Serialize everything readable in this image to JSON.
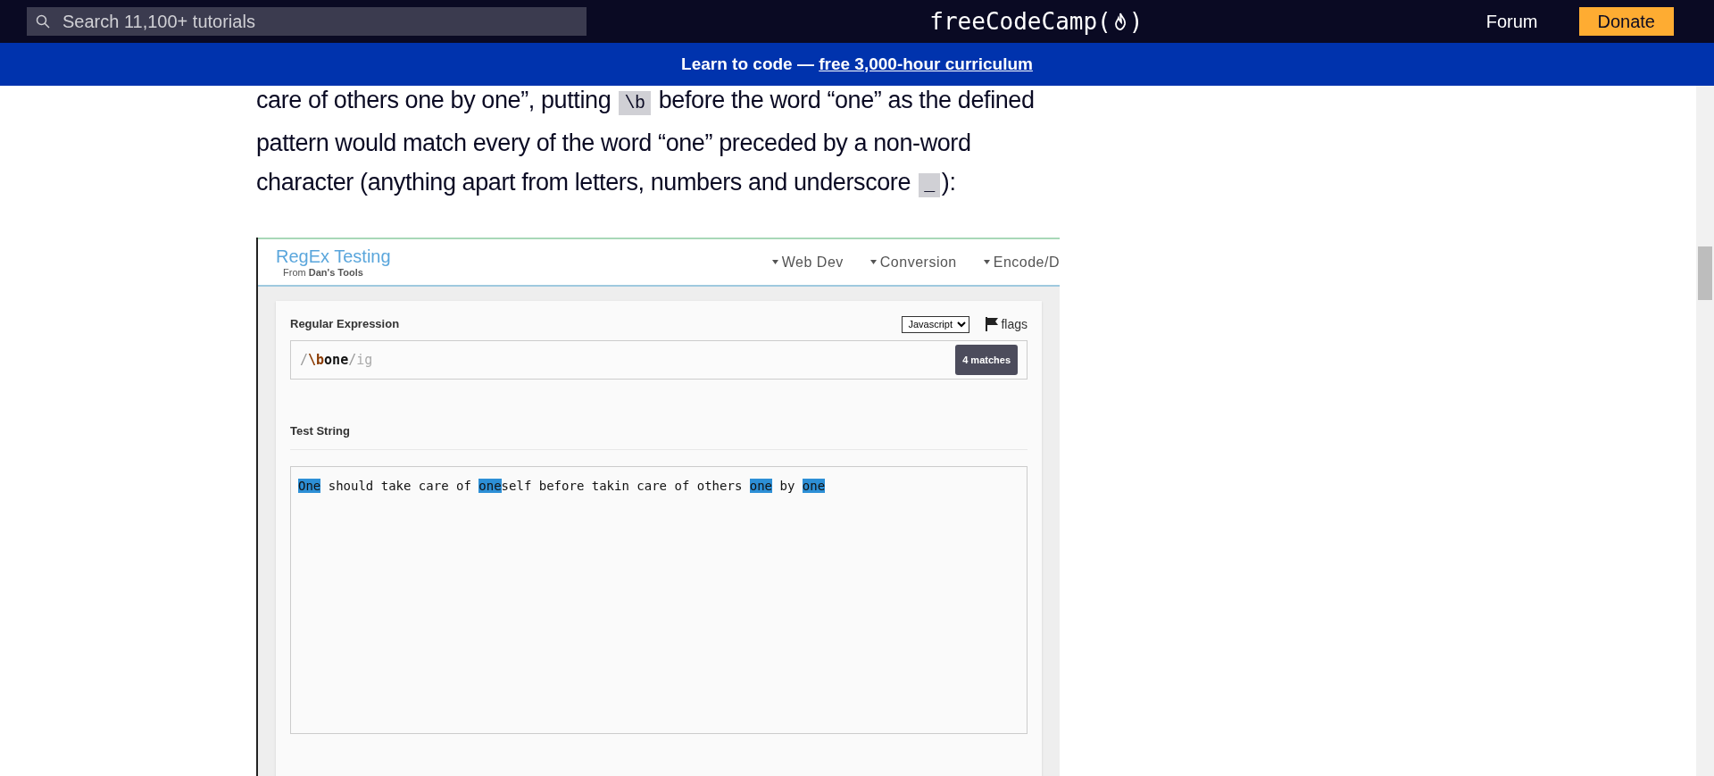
{
  "nav": {
    "search_placeholder": "Search 11,100+ tutorials",
    "logo_before": "freeCodeCamp(",
    "logo_after": ")",
    "forum": "Forum",
    "donate": "Donate"
  },
  "banner": {
    "text": "Learn to code — ",
    "link": "free 3,000-hour curriculum"
  },
  "article": {
    "paragraph": [
      {
        "kind": "text",
        "text": "care of others one by one”, putting "
      },
      {
        "kind": "code",
        "text": "\\b"
      },
      {
        "kind": "text",
        "text": " before the word “one” as the defined pattern would match every of the word “one” preceded by a non-word character (anything apart from letters, numbers and underscore "
      },
      {
        "kind": "code",
        "text": "_"
      },
      {
        "kind": "text",
        "text": "):"
      }
    ]
  },
  "screenshot": {
    "title": "RegEx Testing",
    "subtitle_prefix": "From ",
    "subtitle_bold": "Dan's Tools",
    "menu": [
      "Web Dev",
      "Conversion",
      "Encode/D"
    ],
    "regex_label": "Regular Expression",
    "flavor": "Javascript",
    "flags_label": "flags",
    "expression": [
      {
        "kind": "delimiter",
        "text": "/"
      },
      {
        "kind": "escape",
        "text": "\\b"
      },
      {
        "kind": "literal",
        "text": "one"
      },
      {
        "kind": "delimiter",
        "text": "/"
      },
      {
        "kind": "flags",
        "text": "ig"
      }
    ],
    "matches": "4 matches",
    "test_label": "Test String",
    "test_string": [
      {
        "text": "One",
        "match": true
      },
      {
        "text": " should take care of ",
        "match": false
      },
      {
        "text": "one",
        "match": true
      },
      {
        "text": "self before takin care of others ",
        "match": false
      },
      {
        "text": "one",
        "match": true
      },
      {
        "text": " by ",
        "match": false
      },
      {
        "text": "one",
        "match": true
      }
    ]
  }
}
